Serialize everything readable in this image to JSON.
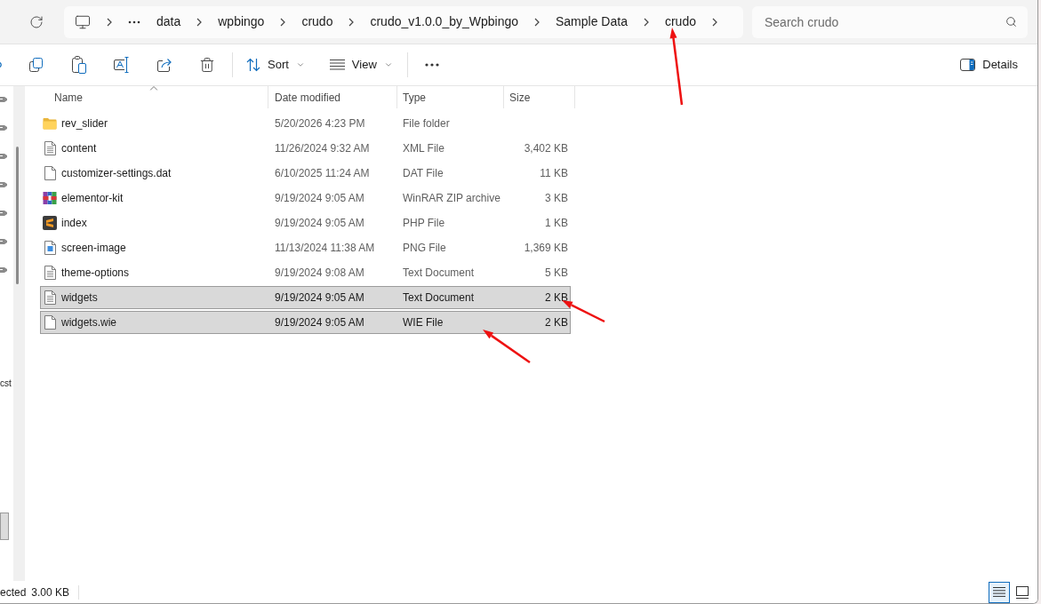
{
  "address_bar": {
    "breadcrumbs": [
      "data",
      "wpbingo",
      "crudo",
      "crudo_v1.0.0_by_Wpbingo",
      "Sample Data",
      "crudo"
    ]
  },
  "search": {
    "placeholder": "Search crudo"
  },
  "toolbar": {
    "sort": "Sort",
    "view": "View",
    "details": "Details"
  },
  "navigation_pane": {
    "text": "cst"
  },
  "table": {
    "columns": [
      {
        "label": "Name",
        "sorted": true
      },
      {
        "label": "Date modified",
        "sorted": false
      },
      {
        "label": "Type",
        "sorted": false
      },
      {
        "label": "Size",
        "sorted": false
      }
    ],
    "rows": [
      {
        "kind": "folder",
        "name": "rev_slider",
        "date": "5/20/2026 4:23 PM",
        "type": "File folder",
        "selected": false
      },
      {
        "kind": "text",
        "name": "content",
        "date": "11/26/2024 9:32 AM",
        "type": "XML File",
        "size": "3,402 KB",
        "selected": false
      },
      {
        "kind": "data",
        "name": "customizer-settings.dat",
        "date": "6/10/2025 11:24 AM",
        "type": "DAT File",
        "size": "11 KB",
        "selected": false
      },
      {
        "kind": "archive",
        "name": "elementor-kit",
        "date": "9/19/2024 9:05 AM",
        "type": "WinRAR ZIP archive",
        "size": "3 KB",
        "selected": false
      },
      {
        "kind": "script",
        "name": "index",
        "date": "9/19/2024 9:05 AM",
        "type": "PHP File",
        "size": "1 KB",
        "selected": false
      },
      {
        "kind": "image",
        "name": "screen-image",
        "date": "11/13/2024 11:38 AM",
        "type": "PNG File",
        "size": "1,369 KB",
        "selected": false
      },
      {
        "kind": "text",
        "name": "theme-options",
        "date": "9/19/2024 9:08 AM",
        "type": "Text Document",
        "size": "5 KB",
        "selected": false
      },
      {
        "kind": "text",
        "name": "widgets",
        "date": "9/19/2024 9:05 AM",
        "type": "Text Document",
        "size": "2 KB",
        "selected": true
      },
      {
        "kind": "data",
        "name": "widgets.wie",
        "date": "9/19/2024 9:05 AM",
        "type": "WIE File",
        "size": "2 KB",
        "selected": true
      }
    ]
  },
  "status_bar": {
    "selection": "ected",
    "size": "3.00 KB",
    "view_modes": [
      {
        "kind": "details",
        "selected": true
      },
      {
        "kind": "tiles",
        "selected": false
      }
    ]
  }
}
